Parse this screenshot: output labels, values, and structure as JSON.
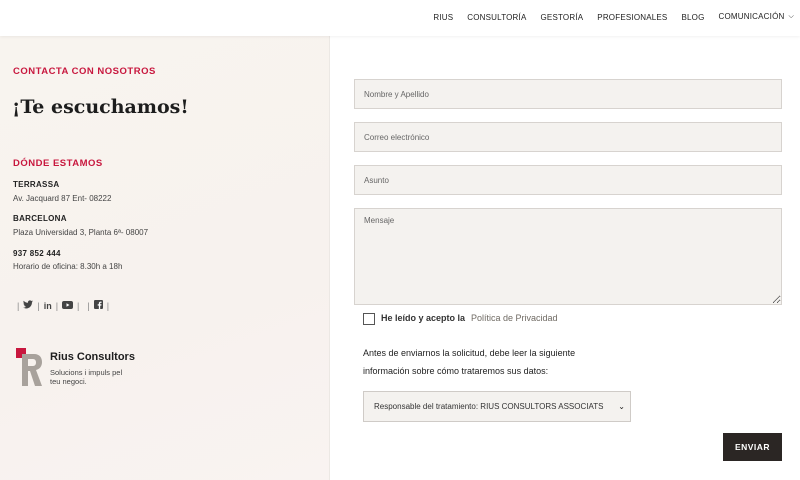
{
  "nav": {
    "items": [
      "RIUS",
      "CONSULTORÍA",
      "GESTORÍA",
      "PROFESIONALES",
      "BLOG"
    ],
    "dropdown_label": "COMUNICACIÓN"
  },
  "contact": {
    "kicker": "CONTACTA CON NOSOTROS",
    "headline": "¡Te escuchamos!",
    "where_title": "DÓNDE ESTAMOS",
    "offices": [
      {
        "city": "TERRASSA",
        "address": "Av. Jacquard 87 Ent- 08222"
      },
      {
        "city": "BARCELONA",
        "address": "Plaza Universidad 3, Planta 6ª- 08007"
      }
    ],
    "phone": "937 852 444",
    "hours": "Horario de oficina: 8.30h a 18h",
    "social_icons": [
      "twitter-icon",
      "linkedin-icon",
      "youtube-icon",
      "facebook-icon"
    ]
  },
  "logo": {
    "name": "Rius Consultors",
    "tagline": "Solucions i impuls pel teu negoci."
  },
  "form": {
    "name_placeholder": "Nombre y Apellido",
    "email_placeholder": "Correo electrónico",
    "subject_placeholder": "Asunto",
    "message_placeholder": "Mensaje",
    "consent_label": "He leído y acepto la",
    "policy_link": "Política de Privacidad",
    "info_line1": "Antes de enviarnos la solicitud, debe leer la siguiente",
    "info_line2": "información sobre cómo trataremos sus datos:",
    "select_value": "Responsable del tratamiento: RIUS CONSULTORS ASSOCIATS",
    "submit_label": "ENVIAR"
  },
  "colors": {
    "accent": "#c8173e",
    "button": "#2b2624",
    "field_bg": "#f4f2ef"
  }
}
